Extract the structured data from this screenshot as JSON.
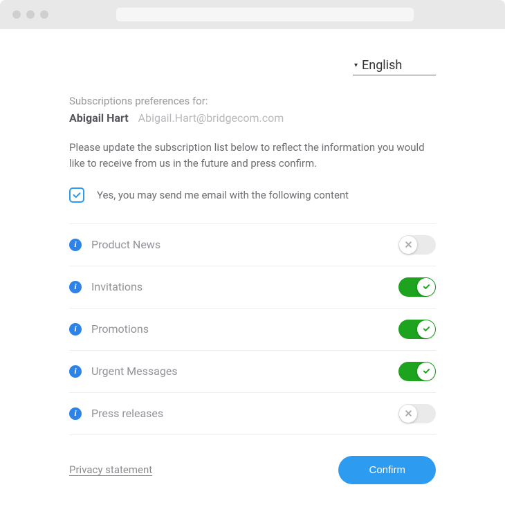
{
  "language": {
    "selected": "English"
  },
  "header": {
    "prefs_for_label": "Subscriptions preferences for:",
    "user_name": "Abigail Hart",
    "user_email": "Abigail.Hart@bridgecom.com"
  },
  "instructions": "Please update the subscription list below to reflect the information you would like to receive from us in the future and press confirm.",
  "consent": {
    "checked": true,
    "label": "Yes, you may send me email with the following content"
  },
  "subscriptions": [
    {
      "label": "Product News",
      "enabled": false
    },
    {
      "label": "Invitations",
      "enabled": true
    },
    {
      "label": "Promotions",
      "enabled": true
    },
    {
      "label": "Urgent Messages",
      "enabled": true
    },
    {
      "label": "Press releases",
      "enabled": false
    }
  ],
  "footer": {
    "privacy_label": "Privacy statement",
    "confirm_label": "Confirm"
  },
  "colors": {
    "accent_blue": "#2d9bf0",
    "toggle_on": "#1da31d",
    "text_muted": "#929398"
  }
}
